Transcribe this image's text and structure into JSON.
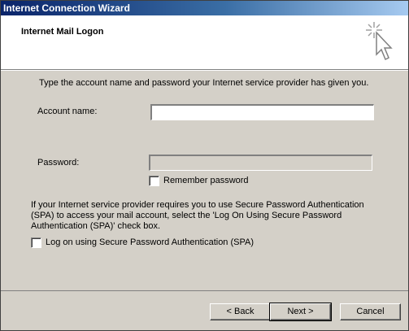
{
  "window": {
    "title": "Internet Connection Wizard"
  },
  "header": {
    "title": "Internet Mail Logon",
    "icon": "wizard-wand-icon"
  },
  "form": {
    "intro": "Type the account name and password your Internet service provider has given you.",
    "account_label": "Account name:",
    "account_value": "",
    "password_label": "Password:",
    "password_value": "",
    "remember_label": "Remember password",
    "remember_checked": false,
    "spa_text": "If your Internet service provider requires you to use Secure Password Authentication (SPA) to access your mail account, select the 'Log On Using Secure Password Authentication (SPA)' check box.",
    "spa_label": "Log on using Secure Password Authentication (SPA)",
    "spa_checked": false
  },
  "buttons": {
    "back": "< Back",
    "next": "Next >",
    "cancel": "Cancel"
  }
}
